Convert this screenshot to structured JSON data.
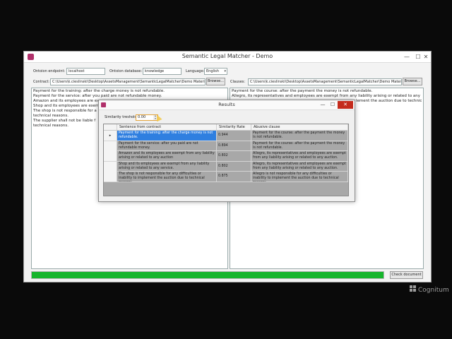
{
  "window": {
    "title": "Semantic Legal Matcher - Demo",
    "minimize": "—",
    "maximize": "☐",
    "close": "✕"
  },
  "settings": {
    "endpoint_label": "Ontoion endpoint:",
    "endpoint_value": "localhost",
    "database_label": "Ontoion database:",
    "database_value": "knowledge",
    "language_label": "Language:",
    "language_value": "English"
  },
  "contract": {
    "label": "Contract:",
    "path": "C:\\Users\\k.cieslinski\\Desktop\\AssetsManagement\\SemanticLegalMatcher\\Demo Material",
    "browse": "Browse...",
    "lines": [
      "Payment for the training: after the charge money is not refundable.",
      "Payment for the service: after you paid are not refundable money.",
      "Amazon and its employees are ex",
      "Shop and its employees are exemp",
      "The shop is not responsible for a",
      "technical reasons.",
      "The supplier shall not be liable f",
      "technical reasons."
    ]
  },
  "clauses": {
    "label": "Clauses:",
    "path": "C:\\Users\\k.cieslinski\\Desktop\\AssetsManagement\\SemanticLegalMatcher\\Demo Material",
    "browse": "Browse...",
    "lines": [
      "Payment for the course: after the payment the money is not refundable.",
      "Allegro, its representatives and employees are exempt from any liability arising or related to any"
    ],
    "tail_fragment": "lement the auction due to technical"
  },
  "progress": {
    "value": 1.0
  },
  "check_button": "Check document",
  "results": {
    "title": "Results",
    "minimize": "—",
    "maximize": "☐",
    "close": "✕",
    "threshold_label": "Similarity treshold:",
    "threshold_value": "0.00",
    "columns": [
      "Sentence from contract",
      "Similarity Rate",
      "Abusive clause"
    ],
    "selected_marker": "▸",
    "rows": [
      {
        "sentence": "Payment for the training: after the charge money is not refundable.",
        "rate": "0.944",
        "clause": "Payment for the course: after the payment the money is not refundable.",
        "selected": true
      },
      {
        "sentence": "Payment for the service: after you paid are not refundable money.",
        "rate": "0.894",
        "clause": "Payment for the course: after the payment the money is not refundable.",
        "selected": false
      },
      {
        "sentence": "Amazon and its employees are exempt from any liability arising or related to any auction",
        "rate": "0.802",
        "clause": "Allegro, its representatives and employees are exempt from any liability arising or related to any auction.",
        "selected": false
      },
      {
        "sentence": "Shop and its employees are exempt from any liability arising or related to any service.",
        "rate": "0.802",
        "clause": "Allegro, its representatives and employees are exempt from any liability arising or related to any auction.",
        "selected": false
      },
      {
        "sentence": "The shop is not responsible for any difficulties or inability to implement the auction due to technical reasons.",
        "rate": "0.875",
        "clause": "Allegro is not responsible for any difficulties or inability to implement the auction due to technical reasons.",
        "selected": false
      }
    ]
  },
  "watermark": "Cognitum"
}
